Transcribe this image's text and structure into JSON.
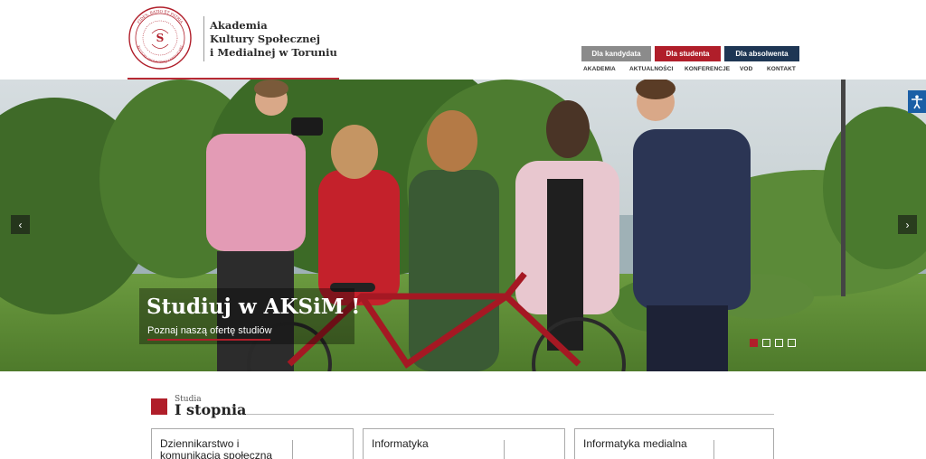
{
  "header": {
    "logo_lines": [
      "Akademia",
      "Kultury Społecznej",
      "i Medialnej w Toruniu"
    ],
    "seal_text": "FIDES, RATIO ET PATRIA",
    "seal_text_bottom": "KULTURY SPOŁECZNEJ I MEDIALNEJ",
    "audience": [
      {
        "label": "Dla kandydata",
        "color": "#8b8b8b"
      },
      {
        "label": "Dla studenta",
        "color": "#b01e2a"
      },
      {
        "label": "Dla absolwenta",
        "color": "#1e3654"
      }
    ],
    "nav": [
      "AKADEMIA",
      "AKTUALNOŚCI",
      "KONFERENCJE",
      "VOD",
      "KONTAKT"
    ]
  },
  "hero": {
    "title": "Studiuj w AKSiM !",
    "subtitle": "Poznaj naszą ofertę studiów",
    "prev_icon": "‹",
    "next_icon": "›",
    "slides": 4,
    "active_slide": 1
  },
  "accessibility": {
    "icon": "accessibility-icon"
  },
  "studies": {
    "small": "Studia",
    "big": "I stopnia",
    "cards": [
      {
        "title": "Dziennikarstwo i komunikacja społeczna"
      },
      {
        "title": "Informatyka"
      },
      {
        "title": "Informatyka medialna"
      }
    ]
  },
  "colors": {
    "brand_red": "#b01e2a",
    "navy": "#1e3654",
    "grey": "#8b8b8b"
  }
}
